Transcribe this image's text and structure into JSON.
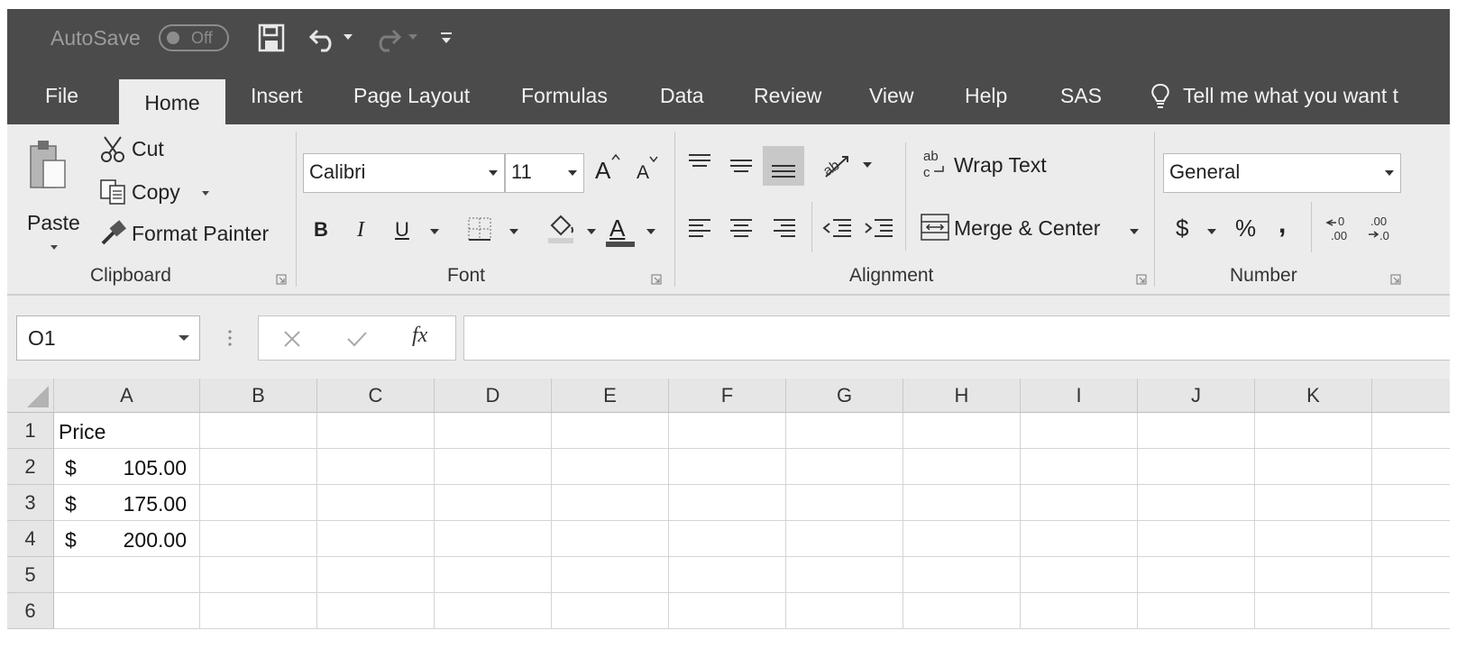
{
  "titlebar": {
    "autosave_label": "AutoSave",
    "autosave_state": "Off",
    "qat_icons": [
      "save-icon",
      "undo-icon",
      "redo-icon",
      "customize-qat-icon"
    ]
  },
  "tabs": [
    {
      "label": "File"
    },
    {
      "label": "Home",
      "active": true
    },
    {
      "label": "Insert"
    },
    {
      "label": "Page Layout"
    },
    {
      "label": "Formulas"
    },
    {
      "label": "Data"
    },
    {
      "label": "Review"
    },
    {
      "label": "View"
    },
    {
      "label": "Help"
    },
    {
      "label": "SAS"
    }
  ],
  "tell_me": "Tell me what you want t",
  "ribbon": {
    "clipboard": {
      "group_label": "Clipboard",
      "paste": "Paste",
      "cut": "Cut",
      "copy": "Copy",
      "format_painter": "Format Painter"
    },
    "font": {
      "group_label": "Font",
      "font_name": "Calibri",
      "font_size": "11",
      "bold": "B",
      "italic": "I",
      "underline": "U",
      "grow": "A",
      "shrink": "A",
      "font_color": "A"
    },
    "alignment": {
      "group_label": "Alignment",
      "wrap_text": "Wrap Text",
      "merge_center": "Merge & Center"
    },
    "number": {
      "group_label": "Number",
      "format": "General",
      "currency": "$",
      "percent": "%",
      "comma": ","
    }
  },
  "formula_bar": {
    "name_box": "O1",
    "formula": ""
  },
  "sheet": {
    "columns": [
      "A",
      "B",
      "C",
      "D",
      "E",
      "F",
      "G",
      "H",
      "I",
      "J",
      "K"
    ],
    "rows": [
      "1",
      "2",
      "3",
      "4",
      "5",
      "6"
    ],
    "a1": "Price",
    "currency_symbol": "$",
    "values": [
      "105.00",
      "175.00",
      "200.00"
    ]
  },
  "colors": {
    "chrome_dark": "#4b4b4b",
    "ribbon_bg": "#ececec",
    "selected_align": "#c8c8c8"
  }
}
